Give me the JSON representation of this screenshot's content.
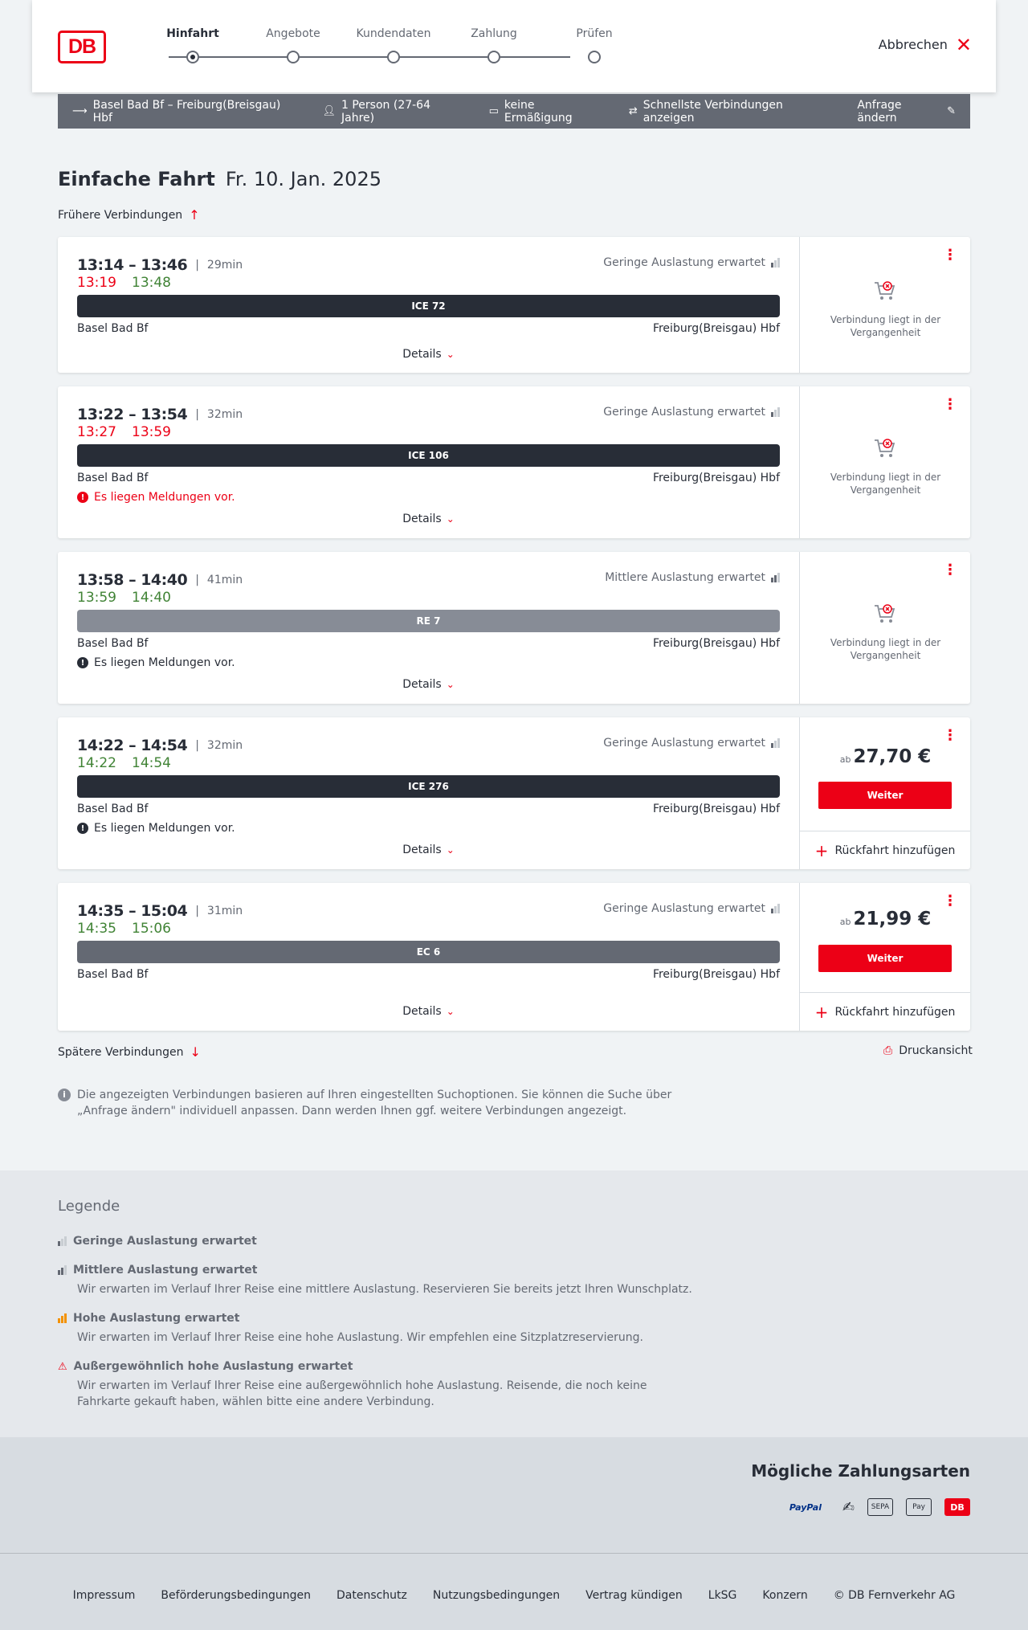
{
  "header": {
    "logo": "DB",
    "steps": [
      "Hinfahrt",
      "Angebote",
      "Kundendaten",
      "Zahlung",
      "Prüfen"
    ],
    "cancel": "Abbrechen"
  },
  "search": {
    "route": "Basel Bad Bf – Freiburg(Breisgau) Hbf",
    "persons": "1 Person (27-64 Jahre)",
    "discount": "keine Ermäßigung",
    "fastest": "Schnellste Verbindungen anzeigen",
    "edit": "Anfrage ändern"
  },
  "page": {
    "title_bold": "Einfache Fahrt",
    "title_date": "Fr. 10. Jan. 2025",
    "earlier": "Frühere Verbindungen",
    "later": "Spätere Verbindungen",
    "print": "Druckansicht",
    "note": "Die angezeigten Verbindungen basieren auf Ihren eingestellten Suchoptionen. Sie können die Suche über „Anfrage ändern\" individuell anpassen. Dann werden Ihnen ggf. weitere Verbindungen angezeigt."
  },
  "common": {
    "from": "Basel Bad Bf",
    "to": "Freiburg(Breisgau) Hbf",
    "details": "Details",
    "past": "Verbindung liegt in der Vergangenheit",
    "ab": "ab",
    "weiter": "Weiter",
    "rueckfahrt": "Rückfahrt hinzufügen",
    "message": "Es liegen Meldungen vor.",
    "sep": "|"
  },
  "connections": [
    {
      "planned": "13:14 – 13:46",
      "duration": "29min",
      "rt_dep": "13:19",
      "rt_arr": "13:48",
      "occupancy": "Geringe Auslastung erwartet",
      "train": "ICE 72"
    },
    {
      "planned": "13:22 – 13:54",
      "duration": "32min",
      "rt_dep": "13:27",
      "rt_arr": "13:59",
      "occupancy": "Geringe Auslastung erwartet",
      "train": "ICE 106"
    },
    {
      "planned": "13:58 – 14:40",
      "duration": "41min",
      "rt_dep": "13:59",
      "rt_arr": "14:40",
      "occupancy": "Mittlere Auslastung erwartet",
      "train": "RE 7"
    },
    {
      "planned": "14:22 – 14:54",
      "duration": "32min",
      "rt_dep": "14:22",
      "rt_arr": "14:54",
      "occupancy": "Geringe Auslastung erwartet",
      "train": "ICE 276",
      "price": "27,70 €"
    },
    {
      "planned": "14:35 – 15:04",
      "duration": "31min",
      "rt_dep": "14:35",
      "rt_arr": "15:06",
      "occupancy": "Geringe Auslastung erwartet",
      "train": "EC 6",
      "price": "21,99 €"
    }
  ],
  "legend": {
    "title": "Legende",
    "items": [
      {
        "title": "Geringe Auslastung erwartet",
        "desc": ""
      },
      {
        "title": "Mittlere Auslastung erwartet",
        "desc": "Wir erwarten im Verlauf Ihrer Reise eine mittlere Auslastung. Reservieren Sie bereits jetzt Ihren Wunschplatz."
      },
      {
        "title": "Hohe Auslastung erwartet",
        "desc": "Wir erwarten im Verlauf Ihrer Reise eine hohe Auslastung. Wir empfehlen eine Sitzplatzreservierung."
      },
      {
        "title": "Außergewöhnlich hohe Auslastung erwartet",
        "desc": "Wir erwarten im Verlauf Ihrer Reise eine außergewöhnlich hohe Auslastung. Reisende, die noch keine Fahrkarte gekauft haben, wählen bitte eine andere Verbindung."
      }
    ]
  },
  "payment": {
    "title": "Mögliche Zahlungsarten",
    "paypal": "PayPal",
    "sepa": "SEPA",
    "applepay": "Pay",
    "db": "DB"
  },
  "footer": [
    "Impressum",
    "Beförderungsbedingungen",
    "Datenschutz",
    "Nutzungsbedingungen",
    "Vertrag kündigen",
    "LkSG",
    "Konzern",
    "© DB Fernverkehr AG"
  ],
  "colors": {
    "accent": "#ec0016",
    "dark": "#282d37",
    "green": "#408335",
    "bar_grey": "#646973"
  }
}
